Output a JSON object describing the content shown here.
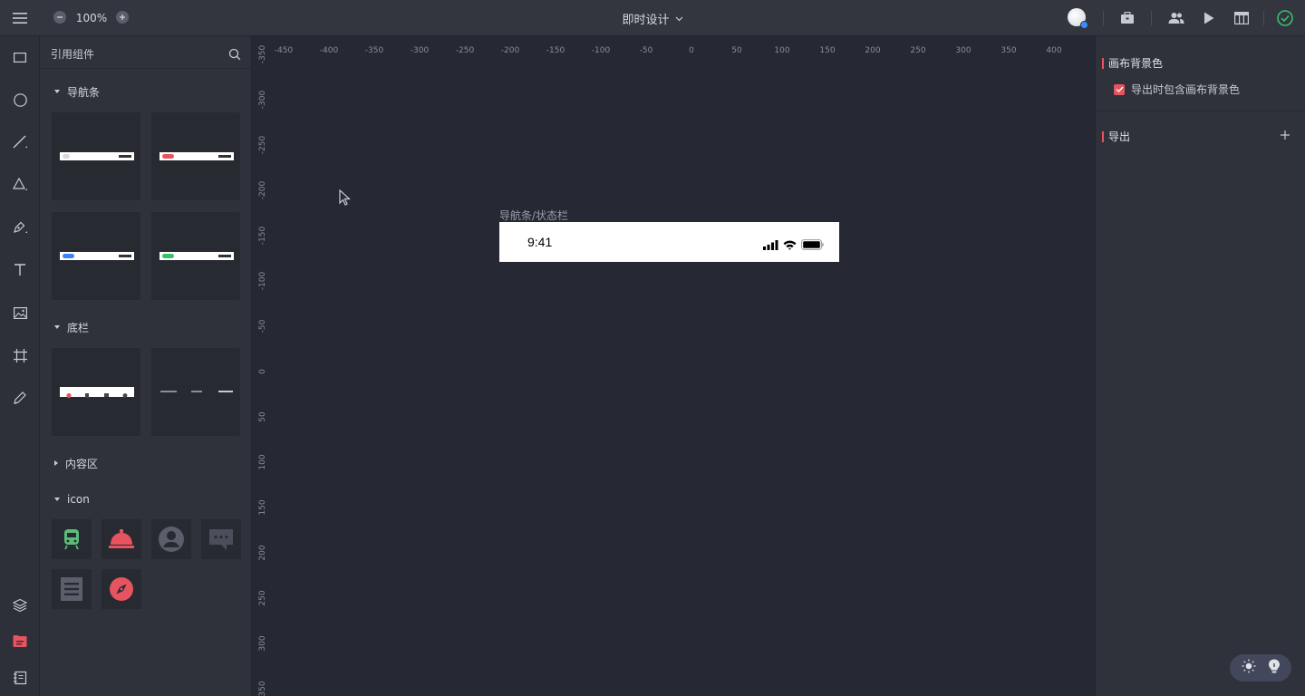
{
  "topbar": {
    "zoom": "100%",
    "title": "即时设计",
    "icons": [
      "menu-icon",
      "zoom-out-icon",
      "zoom-in-icon",
      "chevron-down-icon",
      "avatar",
      "toolbox-icon",
      "users-icon",
      "play-icon",
      "layout-icon",
      "check-circle-icon"
    ],
    "status_color": "#3bbf6a"
  },
  "tools": [
    "rectangle-icon",
    "ellipse-icon",
    "line-icon",
    "triangle-icon",
    "pen-icon",
    "text-icon",
    "image-icon",
    "frame-icon",
    "pencil-icon",
    "layers-icon",
    "components-icon",
    "notes-icon"
  ],
  "panel": {
    "title": "引用组件",
    "sections": [
      {
        "label": "导航条",
        "expanded": true
      },
      {
        "label": "底栏",
        "expanded": true
      },
      {
        "label": "内容区",
        "expanded": false
      },
      {
        "label": "icon",
        "expanded": true
      }
    ],
    "nav_thumbs": [
      "#ffffff",
      "#e6545f",
      "#3b82f6",
      "#3bbf6a"
    ],
    "icon_tiles": [
      {
        "name": "train-icon",
        "color": "#5dbb7a"
      },
      {
        "name": "bell-service-icon",
        "color": "#e6545f"
      },
      {
        "name": "user-circle-icon",
        "color": "#5b5f6b"
      },
      {
        "name": "chat-icon",
        "color": "#4b4f5a"
      },
      {
        "name": "document-icon",
        "color": "#5b5f6b"
      },
      {
        "name": "compass-icon",
        "color": "#e6545f"
      }
    ]
  },
  "canvas": {
    "ruler_h": [
      "-450",
      "-400",
      "-350",
      "-300",
      "-250",
      "-200",
      "-150",
      "-100",
      "-50",
      "0",
      "50",
      "100",
      "150",
      "200",
      "250",
      "300",
      "350",
      "400"
    ],
    "ruler_v": [
      "-350",
      "-300",
      "-250",
      "-200",
      "-150",
      "-100",
      "-50",
      "0",
      "50",
      "100",
      "150",
      "200",
      "250",
      "300",
      "350"
    ],
    "frame_label": "导航条/状态栏",
    "frame_time": "9:41"
  },
  "rpanel": {
    "bg_title": "画布背景色",
    "bg_checkbox": "导出时包含画布背景色",
    "export_title": "导出",
    "accent": "#e6545f"
  }
}
